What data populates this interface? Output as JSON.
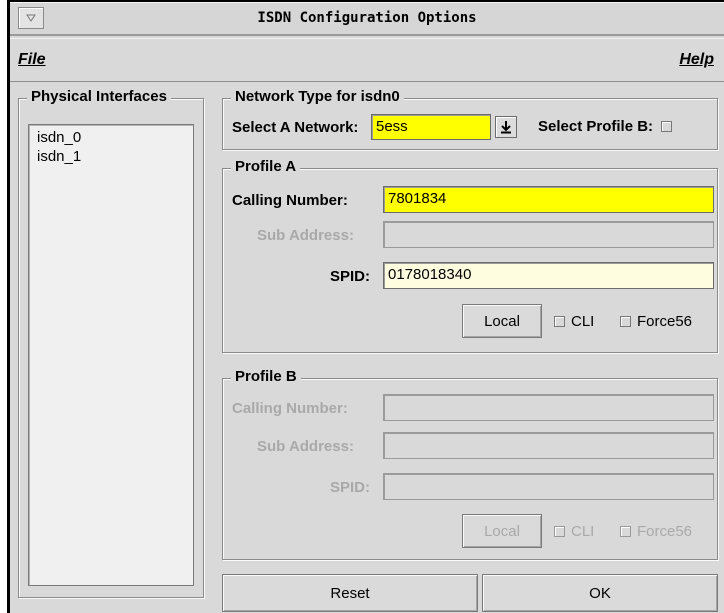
{
  "window": {
    "title": "ISDN Configuration Options"
  },
  "menubar": {
    "file": "File",
    "help": "Help"
  },
  "physical_interfaces": {
    "title": "Physical Interfaces",
    "items": [
      "isdn_0",
      "isdn_1"
    ]
  },
  "network_type": {
    "title": "Network Type  for  isdn0",
    "select_label": "Select A Network:",
    "select_value": "5ess",
    "profile_b_label": "Select Profile B:",
    "profile_b_checked": false
  },
  "profile_a": {
    "title": "Profile A",
    "calling_number_label": "Calling Number:",
    "calling_number_value": "7801834",
    "sub_address_label": "Sub Address:",
    "sub_address_value": "",
    "spid_label": "SPID:",
    "spid_value": "0178018340",
    "local_label": "Local",
    "cli_label": "CLI",
    "force56_label": "Force56"
  },
  "profile_b": {
    "title": "Profile B",
    "calling_number_label": "Calling Number:",
    "calling_number_value": "",
    "sub_address_label": "Sub Address:",
    "sub_address_value": "",
    "spid_label": "SPID:",
    "spid_value": "",
    "local_label": "Local",
    "cli_label": "CLI",
    "force56_label": "Force56"
  },
  "footer": {
    "reset_label": "Reset",
    "ok_label": "OK"
  },
  "colors": {
    "highlight": "#ffff00",
    "input_cream": "#fffde0",
    "window_bg": "#d9d9d9",
    "disabled_text": "#a9a9a9"
  },
  "icons": {
    "window_menu": "window-menu-icon",
    "dropdown": "download-arrow-icon"
  }
}
